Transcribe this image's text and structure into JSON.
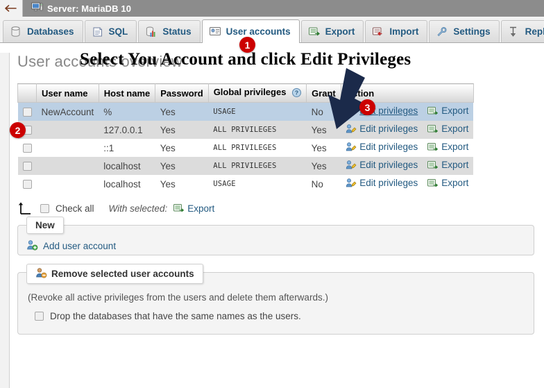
{
  "server_bar": {
    "back_icon": "back-arrow-icon",
    "server_icon": "server-icon",
    "title": "Server: MariaDB 10"
  },
  "tabs": [
    {
      "label": "Databases",
      "icon": "database-icon",
      "active": false
    },
    {
      "label": "SQL",
      "icon": "sql-document-icon",
      "active": false
    },
    {
      "label": "Status",
      "icon": "status-chart-icon",
      "active": false
    },
    {
      "label": "User accounts",
      "icon": "user-card-icon",
      "active": true
    },
    {
      "label": "Export",
      "icon": "export-icon",
      "active": false
    },
    {
      "label": "Import",
      "icon": "import-icon",
      "active": false
    },
    {
      "label": "Settings",
      "icon": "wrench-icon",
      "active": false
    },
    {
      "label": "Replication",
      "icon": "replication-icon",
      "active": false
    }
  ],
  "page": {
    "title": "User accounts overview"
  },
  "users_table": {
    "columns": [
      "",
      "User name",
      "Host name",
      "Password",
      "Global privileges",
      "Grant",
      "Action"
    ],
    "global_privileges_help_icon": "help-question-icon",
    "rows": [
      {
        "user": "NewAccount",
        "host": "%",
        "password": "Yes",
        "privileges": "USAGE",
        "grant": "No",
        "edit": "Edit privileges",
        "export": "Export",
        "shade": "hovered",
        "edit_hover": true
      },
      {
        "user": "",
        "host": "127.0.0.1",
        "password": "Yes",
        "privileges": "ALL PRIVILEGES",
        "grant": "Yes",
        "edit": "Edit privileges",
        "export": "Export",
        "shade": "even",
        "edit_hover": false
      },
      {
        "user": "",
        "host": "::1",
        "password": "Yes",
        "privileges": "ALL PRIVILEGES",
        "grant": "Yes",
        "edit": "Edit privileges",
        "export": "Export",
        "shade": "odd",
        "edit_hover": false
      },
      {
        "user": "",
        "host": "localhost",
        "password": "Yes",
        "privileges": "ALL PRIVILEGES",
        "grant": "Yes",
        "edit": "Edit privileges",
        "export": "Export",
        "shade": "even",
        "edit_hover": false
      },
      {
        "user": "",
        "host": "localhost",
        "password": "Yes",
        "privileges": "USAGE",
        "grant": "No",
        "edit": "Edit privileges",
        "export": "Export",
        "shade": "odd",
        "edit_hover": false
      }
    ]
  },
  "select_bar": {
    "arrow_icon": "select-all-arrow-icon",
    "check_all_label": "Check all",
    "with_selected_label": "With selected:",
    "export_label": "Export",
    "export_icon": "export-icon"
  },
  "new_section": {
    "legend": "New",
    "add_user_label": "Add user account",
    "add_user_icon": "add-user-icon"
  },
  "remove_section": {
    "legend": "Remove selected user accounts",
    "legend_icon": "remove-user-icon",
    "note": "(Revoke all active privileges from the users and delete them afterwards.)",
    "drop_databases_label": "Drop the databases that have the same names as the users."
  },
  "annotation": {
    "text": "Select You Account and click Edit Privileges",
    "badges": [
      "1",
      "2",
      "3"
    ],
    "badge_color": "#cc0000",
    "arrow_icon": "big-down-arrow-icon",
    "arrow_color": "#1b2a4a"
  }
}
